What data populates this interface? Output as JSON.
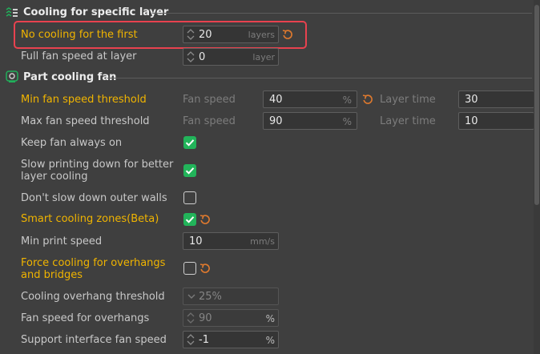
{
  "sections": {
    "cooling_specific": "Cooling for specific layer",
    "part_cooling": "Part cooling fan"
  },
  "rows": {
    "no_cooling": {
      "label": "No cooling for the first",
      "value": "20",
      "unit": "layers"
    },
    "full_fan": {
      "label": "Full fan speed at layer",
      "value": "0",
      "unit": "layer"
    },
    "min_fan": {
      "label": "Min fan speed threshold",
      "fan_speed_label": "Fan speed",
      "fan_value": "40",
      "fan_unit": "%",
      "layer_time_label": "Layer time",
      "layer_time_value": "30"
    },
    "max_fan": {
      "label": "Max fan speed threshold",
      "fan_speed_label": "Fan speed",
      "fan_value": "90",
      "fan_unit": "%",
      "layer_time_label": "Layer time",
      "layer_time_value": "10"
    },
    "keep_fan": {
      "label": "Keep fan always on",
      "checked": true
    },
    "slow_printing": {
      "label": "Slow printing down for better layer cooling",
      "checked": true
    },
    "dont_slow_outer": {
      "label": "Don't slow down outer walls",
      "checked": false
    },
    "smart_cooling": {
      "label": "Smart cooling zones(Beta)",
      "checked": true
    },
    "min_print_speed": {
      "label": "Min print speed",
      "value": "10",
      "unit": "mm/s"
    },
    "force_cooling": {
      "label": "Force cooling for overhangs and bridges",
      "checked": false
    },
    "overhang_threshold": {
      "label": "Cooling overhang threshold",
      "value": "25%"
    },
    "fan_overhangs": {
      "label": "Fan speed for overhangs",
      "value": "90",
      "unit": "%"
    },
    "support_interface": {
      "label": "Support interface fan speed",
      "value": "-1",
      "unit": "%"
    }
  },
  "colors": {
    "modified_label": "#f0b400",
    "checkbox_on": "#22b45a",
    "reset_icon": "#e07a2e",
    "highlight": "#e8424f"
  }
}
